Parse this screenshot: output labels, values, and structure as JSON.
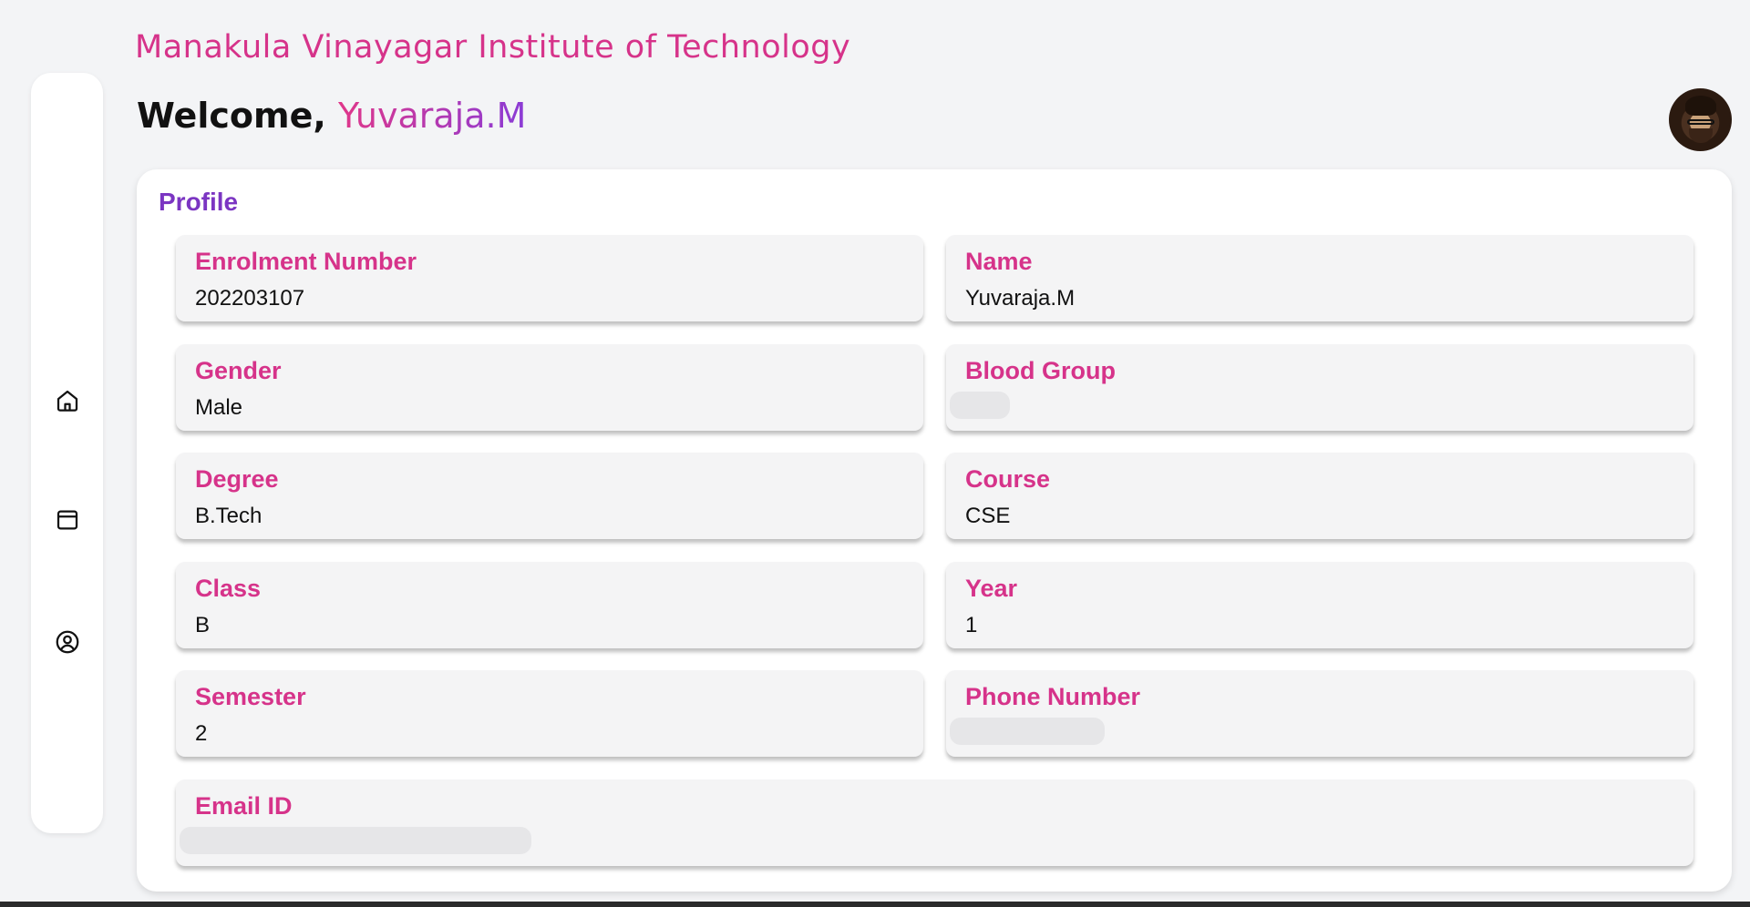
{
  "header": {
    "institution": "Manakula Vinayagar Institute of Technology",
    "welcome_prefix": "Welcome, ",
    "user_name": "Yuvaraja.M"
  },
  "sidebar": {
    "items": [
      {
        "icon": "home-icon",
        "label": "Home"
      },
      {
        "icon": "calendar-icon",
        "label": "Timetable"
      },
      {
        "icon": "user-circle-icon",
        "label": "Profile"
      }
    ]
  },
  "profile": {
    "heading": "Profile",
    "fields": [
      {
        "label": "Enrolment Number",
        "value": "202203107"
      },
      {
        "label": "Name",
        "value": "Yuvaraja.M"
      },
      {
        "label": "Gender",
        "value": "Male"
      },
      {
        "label": "Blood Group",
        "value": ""
      },
      {
        "label": "Degree",
        "value": "B.Tech"
      },
      {
        "label": "Course",
        "value": "CSE"
      },
      {
        "label": "Class",
        "value": "B"
      },
      {
        "label": "Year",
        "value": "1"
      },
      {
        "label": "Semester",
        "value": "2"
      },
      {
        "label": "Phone Number",
        "value": ""
      },
      {
        "label": "Email ID",
        "value": ""
      }
    ]
  },
  "colors": {
    "accent_pink": "#d6338a",
    "accent_purple": "#7b35c2",
    "background": "#f3f4f6",
    "card": "#ffffff",
    "field": "#f4f4f5"
  }
}
